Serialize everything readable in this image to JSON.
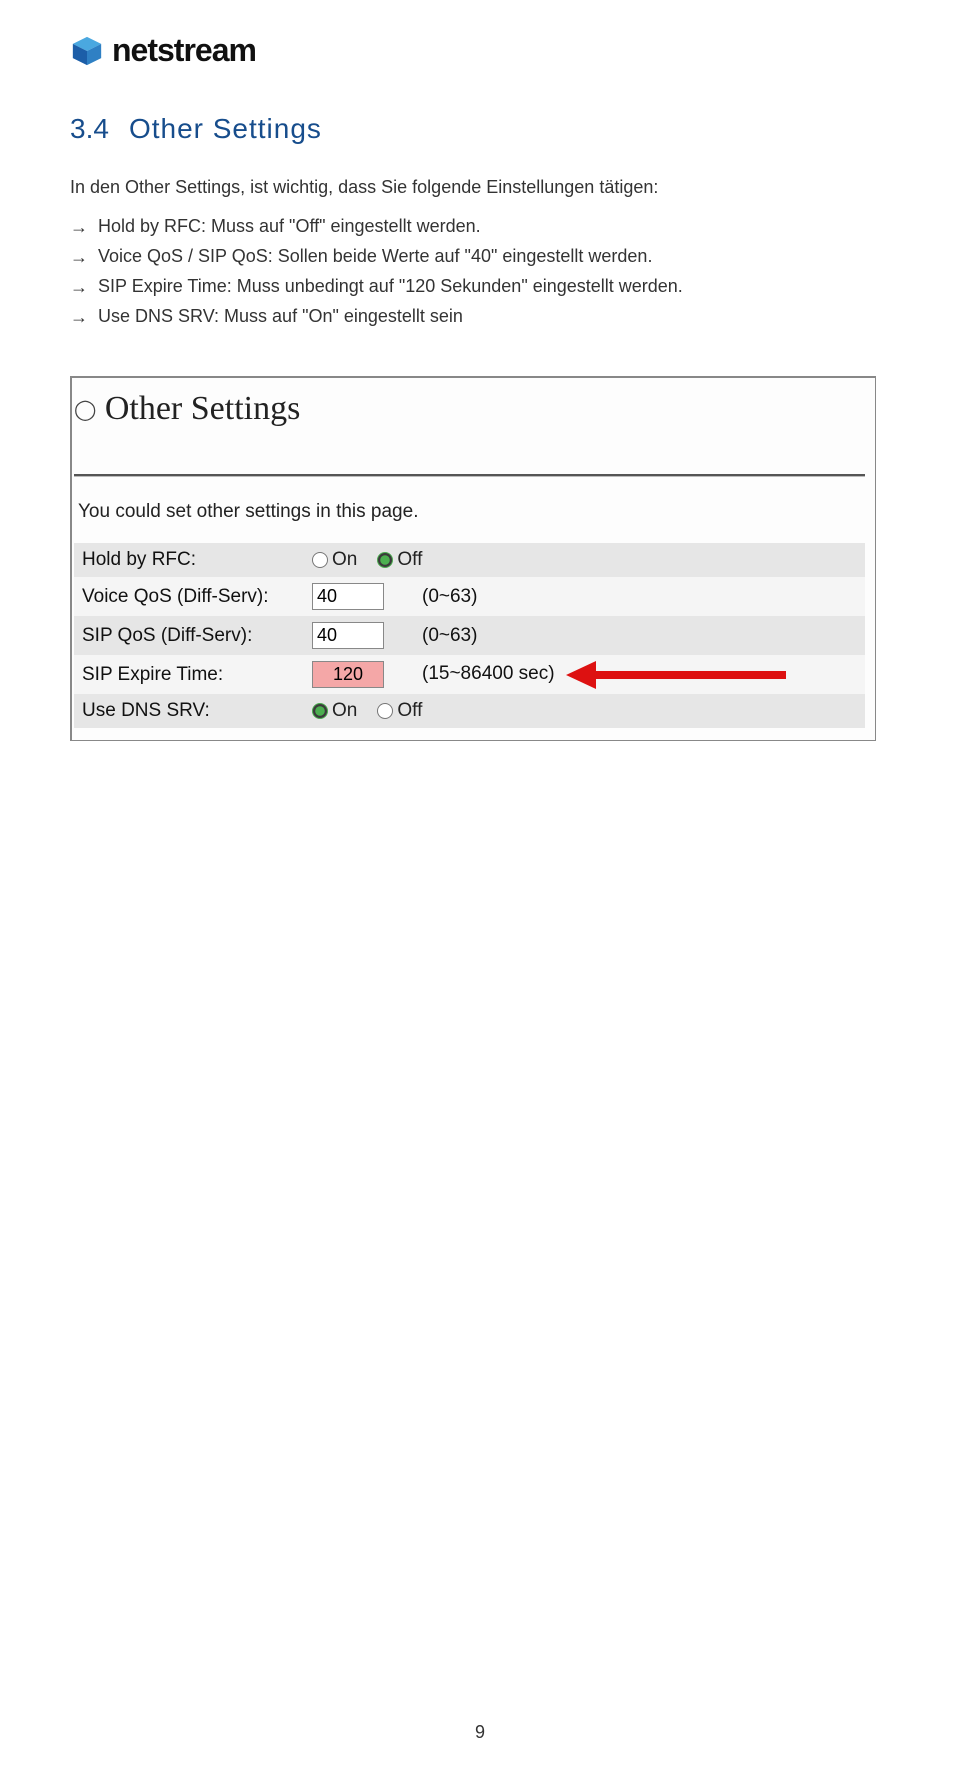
{
  "brand": "netstream",
  "section": {
    "number": "3.4",
    "title": "Other Settings",
    "intro": "In den Other Settings, ist wichtig, dass Sie folgende Einstellungen tätigen:",
    "bullets": [
      "Hold by RFC: Muss auf \"Off\" eingestellt werden.",
      "Voice QoS / SIP QoS: Sollen beide Werte auf \"40\" eingestellt werden.",
      "SIP Expire Time: Muss unbedingt auf \"120 Sekunden\" eingestellt werden.",
      "Use DNS SRV: Muss auf \"On\" eingestellt sein"
    ]
  },
  "panel": {
    "title": "Other Settings",
    "desc": "You could set other settings in this page.",
    "option_on": "On",
    "option_off": "Off",
    "rows": {
      "hold_label": "Hold by RFC:",
      "voiceqos_label": "Voice QoS (Diff-Serv):",
      "voiceqos_value": "40",
      "voiceqos_hint": "(0~63)",
      "sipqos_label": "SIP QoS (Diff-Serv):",
      "sipqos_value": "40",
      "sipqos_hint": "(0~63)",
      "sipexp_label": "SIP Expire Time:",
      "sipexp_value": "120",
      "sipexp_hint": "(15~86400 sec)",
      "dnssrv_label": "Use DNS SRV:"
    }
  },
  "page_number": "9"
}
